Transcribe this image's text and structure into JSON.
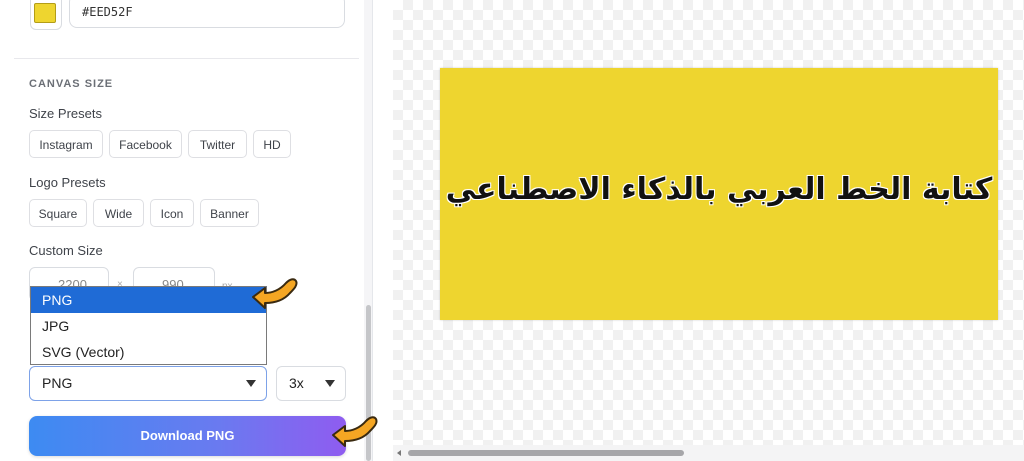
{
  "color": {
    "hex_value": "#EED52F",
    "swatch_color": "#EED52F"
  },
  "canvas_size": {
    "section_title": "CANVAS SIZE",
    "size_presets_label": "Size Presets",
    "size_presets": [
      "Instagram",
      "Facebook",
      "Twitter",
      "HD"
    ],
    "logo_presets_label": "Logo Presets",
    "logo_presets": [
      "Square",
      "Wide",
      "Icon",
      "Banner"
    ],
    "custom_size_label": "Custom Size",
    "width": "2200",
    "height": "990",
    "times_sign": "×",
    "unit": "px"
  },
  "export": {
    "format_options": [
      "PNG",
      "JPG",
      "SVG (Vector)"
    ],
    "selected_format": "PNG",
    "selected_scale": "3x",
    "download_label": "Download PNG"
  },
  "canvas": {
    "text": "كتابة الخط العربي بالذكاء الاصطناعي",
    "background_color": "#EED52F"
  },
  "icons": {
    "caret": "chevron-down-icon",
    "pointer": "hand-pointer-icon"
  }
}
